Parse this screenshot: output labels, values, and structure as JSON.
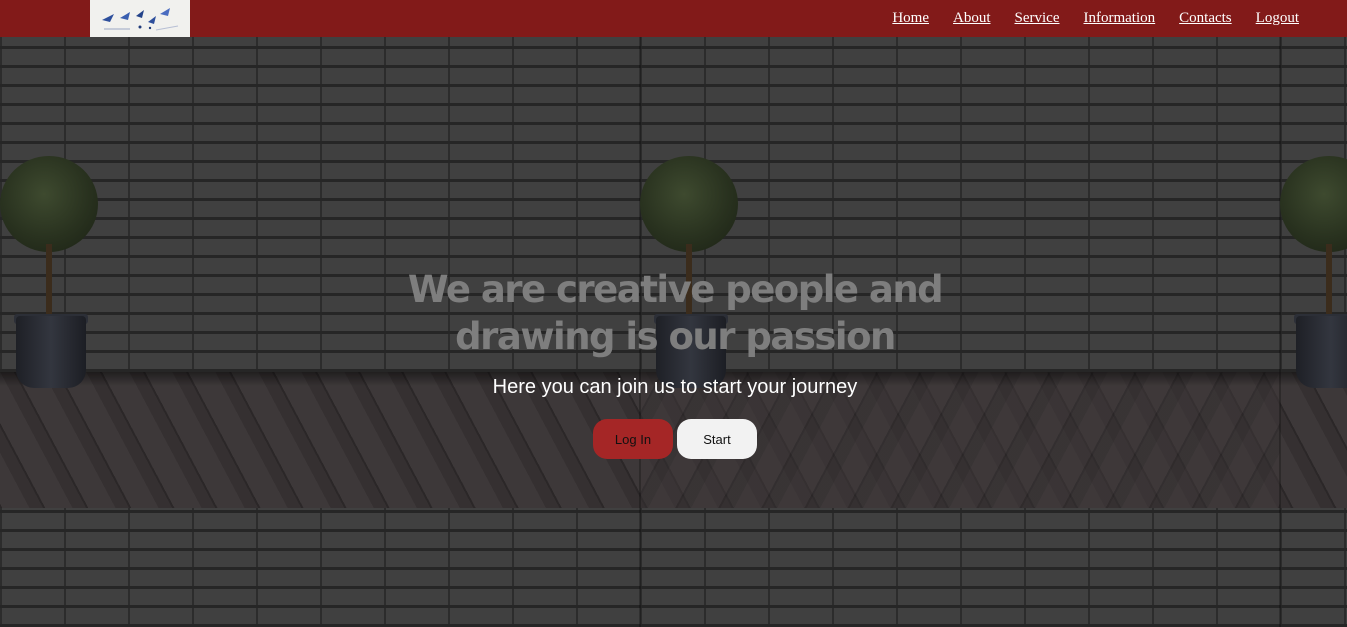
{
  "nav": {
    "logo_icon": "brand-logo-image",
    "links": [
      {
        "label": "Home"
      },
      {
        "label": "About"
      },
      {
        "label": "Service"
      },
      {
        "label": "Information"
      },
      {
        "label": "Contacts"
      },
      {
        "label": "Logout"
      }
    ]
  },
  "hero": {
    "title": "We are creative people and drawing is our passion",
    "subtitle": "Here you can join us to start your journey",
    "login_label": "Log In",
    "start_label": "Start"
  },
  "colors": {
    "navbar": "#821a19",
    "login_button": "#a52626",
    "start_button": "#f2f2f2",
    "title_text": "#7e7e7e",
    "subtitle_text": "#ffffff"
  }
}
